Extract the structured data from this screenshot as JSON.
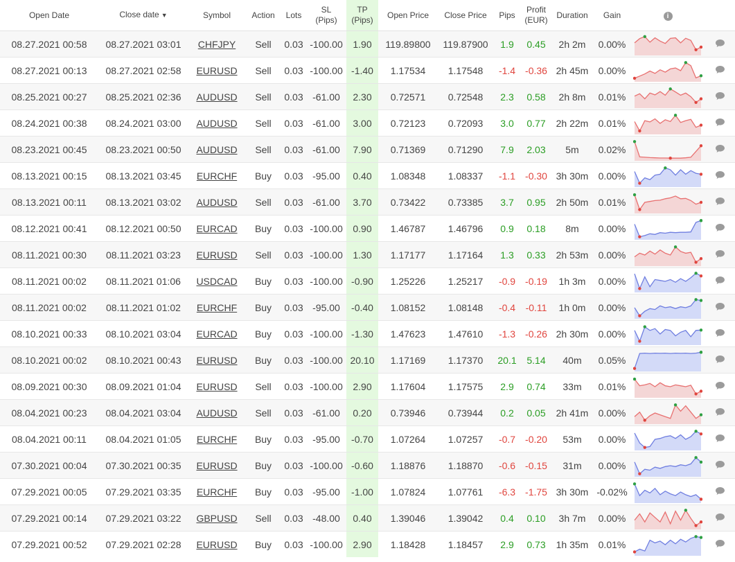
{
  "header": {
    "open_date": "Open Date",
    "close_date": "Close date",
    "close_date_sort": "▼",
    "symbol": "Symbol",
    "action": "Action",
    "lots": "Lots",
    "sl1": "SL",
    "sl2": "(Pips)",
    "tp1": "TP",
    "tp2": "(Pips)",
    "open_price": "Open Price",
    "close_price": "Close Price",
    "pips": "Pips",
    "profit1": "Profit",
    "profit2": "(EUR)",
    "duration": "Duration",
    "gain": "Gain",
    "info": "i"
  },
  "colors": {
    "positive": "#2a9d23",
    "negative": "#e0453e",
    "tp_bg": "#e4f9df",
    "sell_line": "#e87070",
    "sell_fill": "#f4d6d6",
    "buy_line": "#6f7ee0",
    "buy_fill": "#d3daf8",
    "high_dot": "#2ea043",
    "low_dot": "#e0453e",
    "comment_icon": "#9b9b9b"
  },
  "rows": [
    {
      "open": "08.27.2021 00:58",
      "close": "08.27.2021 03:01",
      "symbol": "CHFJPY",
      "action": "Sell",
      "lots": "0.03",
      "sl": "-100.00",
      "tp": "1.90",
      "open_price": "119.89800",
      "close_price": "119.87900",
      "pips": "1.9",
      "profit": "0.45",
      "duration": "2h 2m",
      "gain": "0.00%",
      "spark": [
        0.58,
        0.82,
        0.93,
        0.62,
        0.86,
        0.68,
        0.55,
        0.83,
        0.86,
        0.58,
        0.84,
        0.72,
        0.2,
        0.35
      ]
    },
    {
      "open": "08.27.2021 00:13",
      "close": "08.27.2021 02:58",
      "symbol": "EURUSD",
      "action": "Sell",
      "lots": "0.03",
      "sl": "-100.00",
      "tp": "-1.40",
      "open_price": "1.17534",
      "close_price": "1.17548",
      "pips": "-1.4",
      "profit": "-0.36",
      "duration": "2h 45m",
      "gain": "0.00%",
      "spark": [
        0.08,
        0.2,
        0.32,
        0.48,
        0.35,
        0.55,
        0.42,
        0.6,
        0.65,
        0.5,
        0.95,
        0.78,
        0.1,
        0.22
      ]
    },
    {
      "open": "08.25.2021 00:27",
      "close": "08.25.2021 02:36",
      "symbol": "AUDUSD",
      "action": "Sell",
      "lots": "0.03",
      "sl": "-61.00",
      "tp": "2.30",
      "open_price": "0.72571",
      "close_price": "0.72548",
      "pips": "2.3",
      "profit": "0.58",
      "duration": "2h 8m",
      "gain": "0.01%",
      "spark": [
        0.55,
        0.68,
        0.4,
        0.72,
        0.62,
        0.8,
        0.6,
        0.95,
        0.78,
        0.6,
        0.72,
        0.52,
        0.2,
        0.4
      ]
    },
    {
      "open": "08.24.2021 00:38",
      "close": "08.24.2021 03:00",
      "symbol": "AUDUSD",
      "action": "Sell",
      "lots": "0.03",
      "sl": "-61.00",
      "tp": "3.00",
      "open_price": "0.72123",
      "close_price": "0.72093",
      "pips": "3.0",
      "profit": "0.77",
      "duration": "2h 22m",
      "gain": "0.01%",
      "spark": [
        0.6,
        0.08,
        0.65,
        0.58,
        0.75,
        0.5,
        0.7,
        0.6,
        0.95,
        0.55,
        0.65,
        0.72,
        0.28,
        0.4
      ]
    },
    {
      "open": "08.23.2021 00:45",
      "close": "08.23.2021 00:50",
      "symbol": "AUDUSD",
      "action": "Sell",
      "lots": "0.03",
      "sl": "-61.00",
      "tp": "7.90",
      "open_price": "0.71369",
      "close_price": "0.71290",
      "pips": "7.9",
      "profit": "2.03",
      "duration": "5m",
      "gain": "0.02%",
      "spark": [
        0.95,
        0.1,
        0.08,
        0.06,
        0.05,
        0.04,
        0.04,
        0.03,
        0.03,
        0.03,
        0.05,
        0.08,
        0.4,
        0.72
      ]
    },
    {
      "open": "08.13.2021 00:15",
      "close": "08.13.2021 03:45",
      "symbol": "EURCHF",
      "action": "Buy",
      "lots": "0.03",
      "sl": "-95.00",
      "tp": "0.40",
      "open_price": "1.08348",
      "close_price": "1.08337",
      "pips": "-1.1",
      "profit": "-0.30",
      "duration": "3h 30m",
      "gain": "0.00%",
      "spark": [
        0.75,
        0.1,
        0.4,
        0.3,
        0.55,
        0.6,
        0.95,
        0.85,
        0.55,
        0.85,
        0.6,
        0.8,
        0.65,
        0.6
      ]
    },
    {
      "open": "08.13.2021 00:11",
      "close": "08.13.2021 03:02",
      "symbol": "AUDUSD",
      "action": "Sell",
      "lots": "0.03",
      "sl": "-61.00",
      "tp": "3.70",
      "open_price": "0.73422",
      "close_price": "0.73385",
      "pips": "3.7",
      "profit": "0.95",
      "duration": "2h 50m",
      "gain": "0.01%",
      "spark": [
        0.92,
        0.1,
        0.5,
        0.55,
        0.6,
        0.62,
        0.7,
        0.75,
        0.85,
        0.7,
        0.72,
        0.6,
        0.4,
        0.5
      ]
    },
    {
      "open": "08.12.2021 00:41",
      "close": "08.12.2021 00:50",
      "symbol": "EURCAD",
      "action": "Buy",
      "lots": "0.03",
      "sl": "-100.00",
      "tp": "0.90",
      "open_price": "1.46787",
      "close_price": "1.46796",
      "pips": "0.9",
      "profit": "0.18",
      "duration": "8m",
      "gain": "0.00%",
      "spark": [
        0.75,
        0.05,
        0.12,
        0.22,
        0.18,
        0.28,
        0.25,
        0.3,
        0.28,
        0.3,
        0.3,
        0.32,
        0.85,
        0.95
      ]
    },
    {
      "open": "08.11.2021 00:30",
      "close": "08.11.2021 03:23",
      "symbol": "EURUSD",
      "action": "Sell",
      "lots": "0.03",
      "sl": "-100.00",
      "tp": "1.30",
      "open_price": "1.17177",
      "close_price": "1.17164",
      "pips": "1.3",
      "profit": "0.33",
      "duration": "2h 53m",
      "gain": "0.00%",
      "spark": [
        0.4,
        0.6,
        0.5,
        0.72,
        0.55,
        0.78,
        0.6,
        0.5,
        0.95,
        0.7,
        0.6,
        0.65,
        0.1,
        0.3
      ]
    },
    {
      "open": "08.11.2021 00:02",
      "close": "08.11.2021 01:06",
      "symbol": "USDCAD",
      "action": "Buy",
      "lots": "0.03",
      "sl": "-100.00",
      "tp": "-0.90",
      "open_price": "1.25226",
      "close_price": "1.25217",
      "pips": "-0.9",
      "profit": "-0.19",
      "duration": "1h 3m",
      "gain": "0.00%",
      "spark": [
        0.92,
        0.1,
        0.75,
        0.2,
        0.6,
        0.55,
        0.5,
        0.6,
        0.45,
        0.65,
        0.5,
        0.7,
        0.95,
        0.8
      ]
    },
    {
      "open": "08.11.2021 00:02",
      "close": "08.11.2021 01:02",
      "symbol": "EURCHF",
      "action": "Buy",
      "lots": "0.03",
      "sl": "-95.00",
      "tp": "-0.40",
      "open_price": "1.08152",
      "close_price": "1.08148",
      "pips": "-0.4",
      "profit": "-0.11",
      "duration": "1h 0m",
      "gain": "0.00%",
      "spark": [
        0.5,
        0.05,
        0.3,
        0.45,
        0.4,
        0.6,
        0.5,
        0.55,
        0.45,
        0.55,
        0.5,
        0.6,
        0.95,
        0.9
      ]
    },
    {
      "open": "08.10.2021 00:33",
      "close": "08.10.2021 03:04",
      "symbol": "EURCAD",
      "action": "Buy",
      "lots": "0.03",
      "sl": "-100.00",
      "tp": "-1.30",
      "open_price": "1.47623",
      "close_price": "1.47610",
      "pips": "-1.3",
      "profit": "-0.26",
      "duration": "2h 30m",
      "gain": "0.00%",
      "spark": [
        0.7,
        0.1,
        0.9,
        0.7,
        0.8,
        0.5,
        0.75,
        0.7,
        0.4,
        0.6,
        0.7,
        0.35,
        0.7,
        0.72
      ]
    },
    {
      "open": "08.10.2021 00:02",
      "close": "08.10.2021 00:43",
      "symbol": "EURUSD",
      "action": "Buy",
      "lots": "0.03",
      "sl": "-100.00",
      "tp": "20.10",
      "open_price": "1.17169",
      "close_price": "1.17370",
      "pips": "20.1",
      "profit": "5.14",
      "duration": "40m",
      "gain": "0.05%",
      "spark": [
        0.05,
        0.88,
        0.9,
        0.88,
        0.9,
        0.89,
        0.9,
        0.88,
        0.9,
        0.89,
        0.9,
        0.88,
        0.9,
        0.95
      ]
    },
    {
      "open": "08.09.2021 00:30",
      "close": "08.09.2021 01:04",
      "symbol": "EURUSD",
      "action": "Sell",
      "lots": "0.03",
      "sl": "-100.00",
      "tp": "2.90",
      "open_price": "1.17604",
      "close_price": "1.17575",
      "pips": "2.9",
      "profit": "0.74",
      "duration": "33m",
      "gain": "0.01%",
      "spark": [
        0.92,
        0.55,
        0.6,
        0.68,
        0.5,
        0.72,
        0.55,
        0.5,
        0.6,
        0.55,
        0.5,
        0.58,
        0.1,
        0.25
      ]
    },
    {
      "open": "08.04.2021 00:23",
      "close": "08.04.2021 03:04",
      "symbol": "AUDUSD",
      "action": "Sell",
      "lots": "0.03",
      "sl": "-61.00",
      "tp": "0.20",
      "open_price": "0.73946",
      "close_price": "0.73944",
      "pips": "0.2",
      "profit": "0.05",
      "duration": "2h 41m",
      "gain": "0.00%",
      "spark": [
        0.3,
        0.55,
        0.1,
        0.35,
        0.5,
        0.4,
        0.3,
        0.2,
        0.95,
        0.6,
        0.9,
        0.55,
        0.2,
        0.4
      ]
    },
    {
      "open": "08.04.2021 00:11",
      "close": "08.04.2021 01:05",
      "symbol": "EURCHF",
      "action": "Buy",
      "lots": "0.03",
      "sl": "-95.00",
      "tp": "-0.70",
      "open_price": "1.07264",
      "close_price": "1.07257",
      "pips": "-0.7",
      "profit": "-0.20",
      "duration": "53m",
      "gain": "0.00%",
      "spark": [
        0.85,
        0.3,
        0.05,
        0.1,
        0.5,
        0.55,
        0.65,
        0.7,
        0.55,
        0.75,
        0.5,
        0.65,
        0.95,
        0.8
      ]
    },
    {
      "open": "07.30.2021 00:04",
      "close": "07.30.2021 00:35",
      "symbol": "EURUSD",
      "action": "Buy",
      "lots": "0.03",
      "sl": "-100.00",
      "tp": "-0.60",
      "open_price": "1.18876",
      "close_price": "1.18870",
      "pips": "-0.6",
      "profit": "-0.15",
      "duration": "31m",
      "gain": "0.00%",
      "spark": [
        0.7,
        0.05,
        0.3,
        0.25,
        0.42,
        0.35,
        0.45,
        0.5,
        0.45,
        0.55,
        0.5,
        0.6,
        0.95,
        0.7
      ]
    },
    {
      "open": "07.29.2021 00:05",
      "close": "07.29.2021 03:35",
      "symbol": "EURCHF",
      "action": "Buy",
      "lots": "0.03",
      "sl": "-95.00",
      "tp": "-1.00",
      "open_price": "1.07824",
      "close_price": "1.07761",
      "pips": "-6.3",
      "profit": "-1.75",
      "duration": "3h 30m",
      "gain": "-0.02%",
      "spark": [
        0.95,
        0.3,
        0.6,
        0.45,
        0.7,
        0.35,
        0.55,
        0.4,
        0.3,
        0.5,
        0.35,
        0.25,
        0.35,
        0.1
      ]
    },
    {
      "open": "07.29.2021 00:14",
      "close": "07.29.2021 03:22",
      "symbol": "GBPUSD",
      "action": "Sell",
      "lots": "0.03",
      "sl": "-48.00",
      "tp": "0.40",
      "open_price": "1.39046",
      "close_price": "1.39042",
      "pips": "0.4",
      "profit": "0.10",
      "duration": "3h 7m",
      "gain": "0.00%",
      "spark": [
        0.4,
        0.75,
        0.3,
        0.8,
        0.55,
        0.3,
        0.85,
        0.2,
        0.9,
        0.4,
        0.95,
        0.5,
        0.1,
        0.3
      ]
    },
    {
      "open": "07.29.2021 00:52",
      "close": "07.29.2021 02:28",
      "symbol": "EURUSD",
      "action": "Buy",
      "lots": "0.03",
      "sl": "-100.00",
      "tp": "2.90",
      "open_price": "1.18428",
      "close_price": "1.18457",
      "pips": "2.9",
      "profit": "0.73",
      "duration": "1h 35m",
      "gain": "0.01%",
      "spark": [
        0.1,
        0.25,
        0.15,
        0.75,
        0.6,
        0.7,
        0.5,
        0.75,
        0.55,
        0.8,
        0.65,
        0.85,
        0.95,
        0.9
      ]
    }
  ]
}
